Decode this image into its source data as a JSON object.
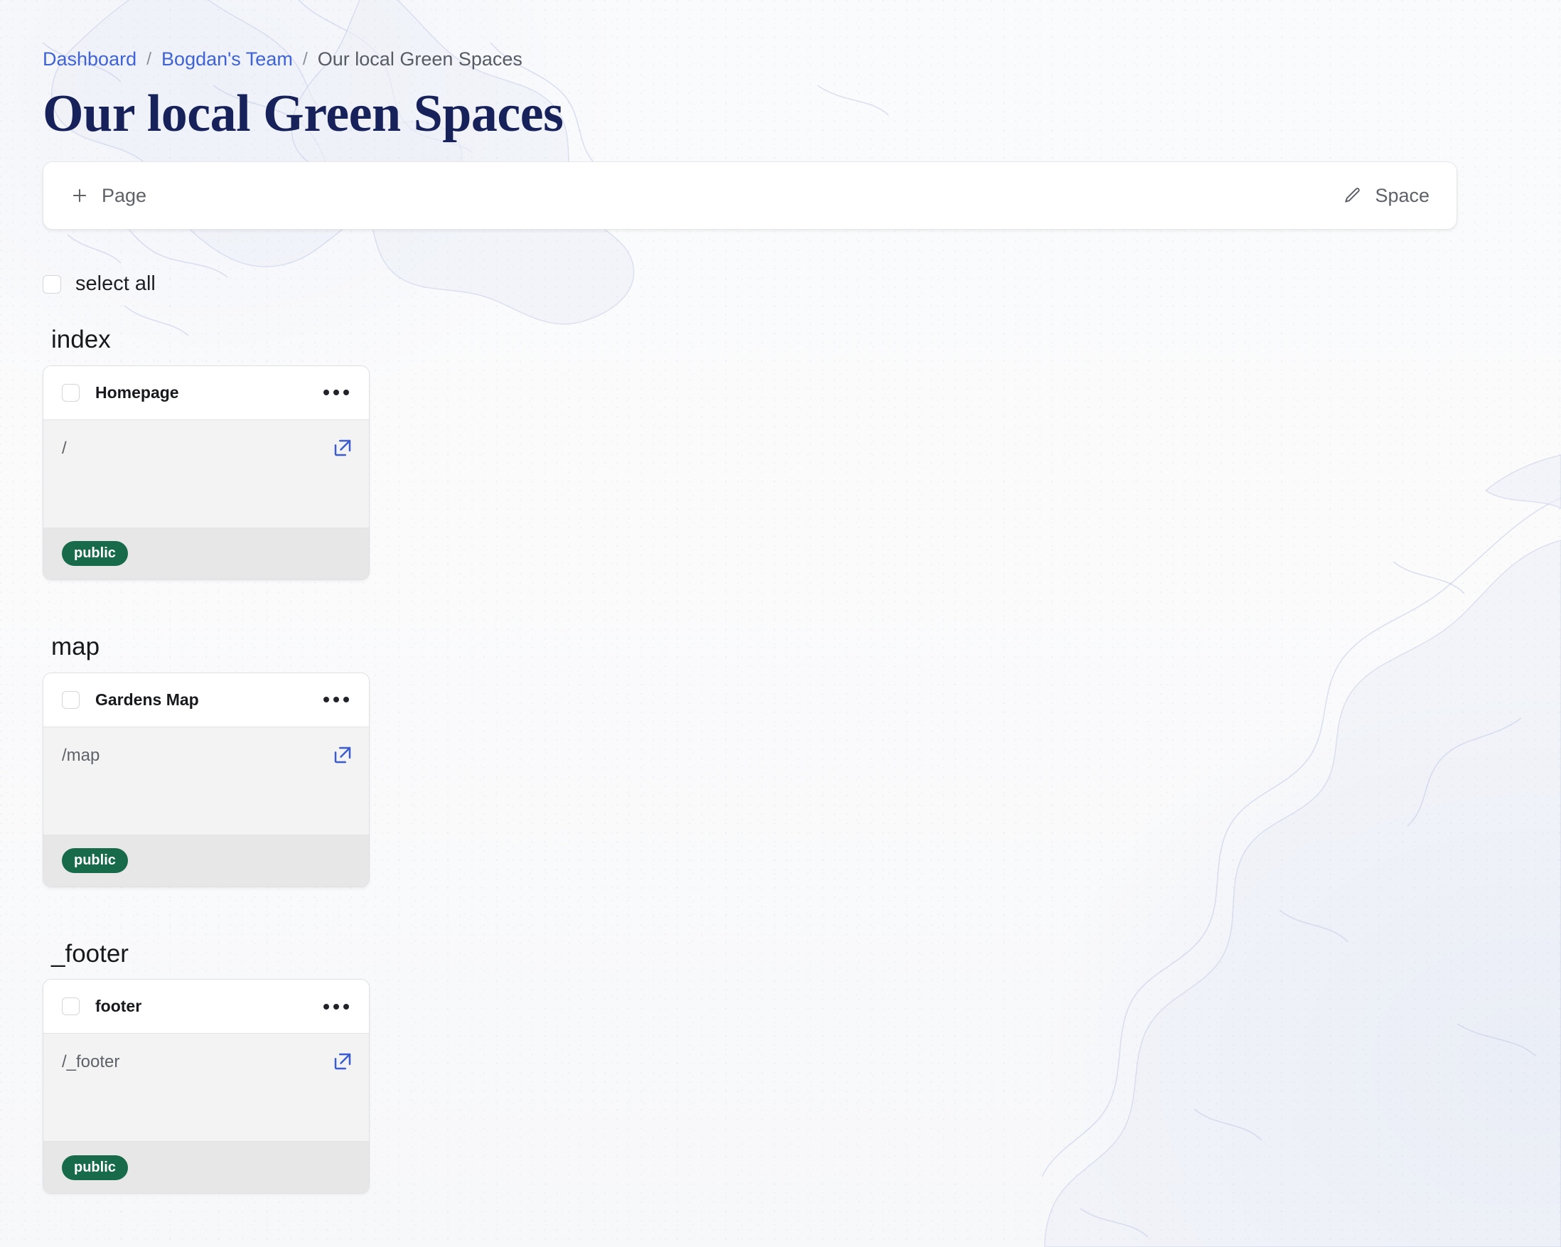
{
  "breadcrumb": {
    "items": [
      {
        "label": "Dashboard",
        "type": "link"
      },
      {
        "label": "Bogdan's Team",
        "type": "link"
      },
      {
        "label": "Our local Green Spaces",
        "type": "current"
      }
    ],
    "separator": "/"
  },
  "page_title": "Our local Green Spaces",
  "toolbar": {
    "add_page_label": "Page",
    "add_page_icon": "plus-icon",
    "edit_space_label": "Space",
    "edit_space_icon": "pencil-icon"
  },
  "select_all": {
    "label": "select all",
    "checked": false
  },
  "colors": {
    "breadcrumb_link": "#3f63d4",
    "breadcrumb_current": "#575b63",
    "title": "#17215a",
    "badge_public_bg": "#176b4b",
    "external_link_icon": "#3b5bd0",
    "card_body_bg": "#f3f3f4",
    "card_footer_bg": "#e7e7e8",
    "page_bg": "#fbfbfc"
  },
  "sections": [
    {
      "title": "index",
      "cards": [
        {
          "title": "Homepage",
          "path": "/",
          "badge": "public",
          "checked": false,
          "menu_icon": "ellipsis-icon",
          "open_icon": "external-link-icon"
        }
      ]
    },
    {
      "title": "map",
      "cards": [
        {
          "title": "Gardens Map",
          "path": "/map",
          "badge": "public",
          "checked": false,
          "menu_icon": "ellipsis-icon",
          "open_icon": "external-link-icon"
        }
      ]
    },
    {
      "title": "_footer",
      "cards": [
        {
          "title": "footer",
          "path": "/_footer",
          "badge": "public",
          "checked": false,
          "menu_icon": "ellipsis-icon",
          "open_icon": "external-link-icon"
        }
      ]
    }
  ]
}
